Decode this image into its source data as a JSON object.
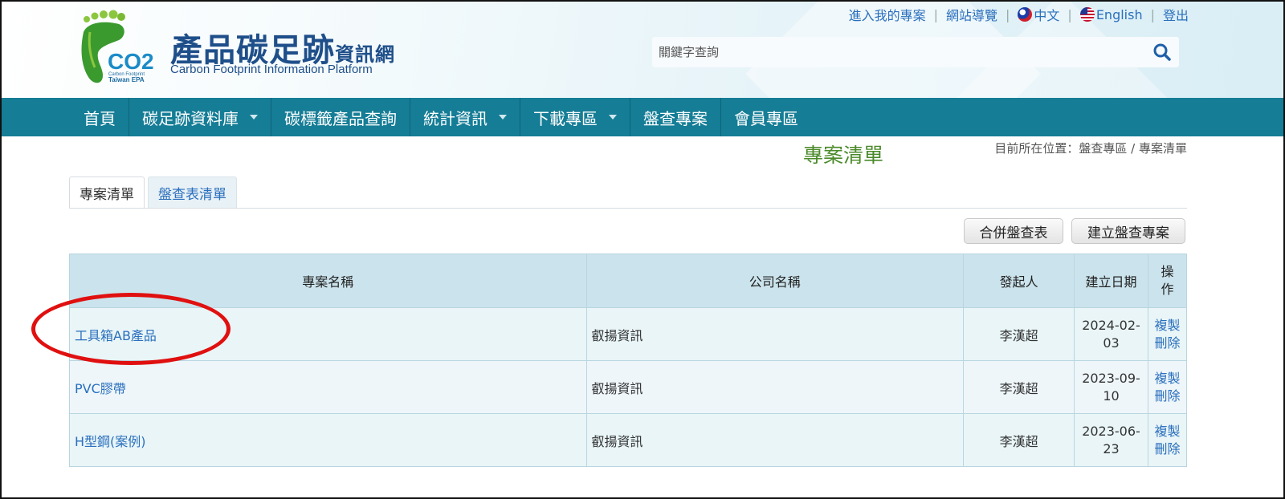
{
  "header": {
    "logo_co2": "CO2",
    "logo_tag_line1": "Carbon Footprint",
    "logo_tag_line2": "Taiwan EPA",
    "logo_title": "產品碳足跡",
    "logo_title_small": "資訊網",
    "logo_subtitle": "Carbon Footprint Information Platform",
    "toplinks": {
      "my_projects": "進入我的專案",
      "sitemap": "網站導覽",
      "chinese": "中文",
      "english": "English",
      "logout": "登出",
      "separator": "|"
    },
    "search": {
      "placeholder": "關鍵字查詢"
    }
  },
  "nav": {
    "items": [
      {
        "label": "首頁"
      },
      {
        "label": "碳足跡資料庫"
      },
      {
        "label": "碳標籤產品查詢"
      },
      {
        "label": "統計資訊"
      },
      {
        "label": "下載專區"
      },
      {
        "label": "盤查專案"
      },
      {
        "label": "會員專區"
      }
    ]
  },
  "page": {
    "title": "專案清單",
    "breadcrumb": "目前所在位置：盤查專區 / 專案清單"
  },
  "tabs": [
    {
      "label": "專案清單",
      "active": true
    },
    {
      "label": "盤查表清單",
      "active": false
    }
  ],
  "actions": {
    "merge_label": "合併盤查表",
    "create_label": "建立盤查專案"
  },
  "table": {
    "headers": {
      "name": "專案名稱",
      "company": "公司名稱",
      "initiator": "發起人",
      "date": "建立日期",
      "ops": "操作"
    },
    "rows": [
      {
        "name": "工具箱AB產品",
        "company": "叡揚資訊",
        "initiator": "李漢超",
        "date": "2024-02-03",
        "copy": "複製",
        "delete": "刪除"
      },
      {
        "name": "PVC膠帶",
        "company": "叡揚資訊",
        "initiator": "李漢超",
        "date": "2023-09-10",
        "copy": "複製",
        "delete": "刪除"
      },
      {
        "name": "H型鋼(案例)",
        "company": "叡揚資訊",
        "initiator": "李漢超",
        "date": "2023-06-23",
        "copy": "複製",
        "delete": "刪除"
      }
    ]
  },
  "colors": {
    "nav_bg": "#157d96",
    "link": "#2a6fbd",
    "title_green": "#4a8a2a",
    "annotation_red": "#e01010"
  }
}
